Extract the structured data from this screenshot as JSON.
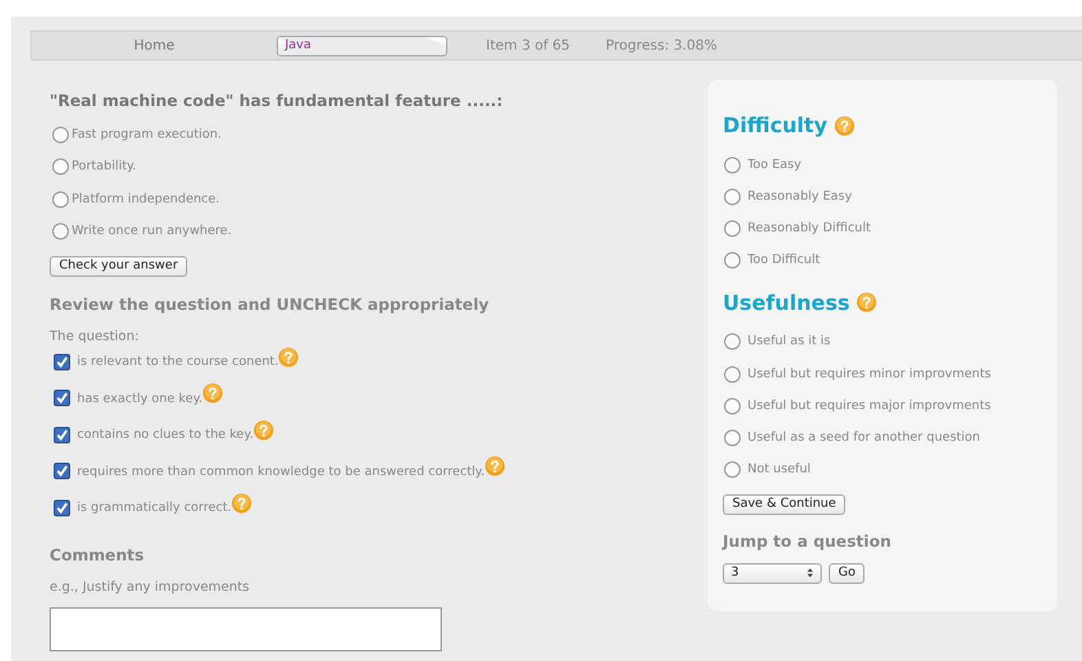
{
  "breadcrumb": [
    {
      "label": "Home",
      "selected": false
    },
    {
      "label": "Java",
      "selected": true
    }
  ],
  "position": "Item 3 of 65",
  "progress": "Progress: 3.08%",
  "question": {
    "title": "\"Real machine code\" has fundamental feature .....:",
    "options": [
      {
        "label": "Fast program execution.",
        "selected": false
      },
      {
        "label": "Portability.",
        "selected": false
      },
      {
        "label": "Platform independence.",
        "selected": false
      },
      {
        "label": "Write once run anywhere.",
        "selected": false
      }
    ],
    "check_button": "Check your answer"
  },
  "review": {
    "heading": "Review the question and UNCHECK appropriately",
    "intro": "The question:",
    "criteria": [
      {
        "label": "is relevant to the course conent.",
        "checked": true
      },
      {
        "label": "has exactly one key.",
        "checked": true
      },
      {
        "label": "contains no clues to the key.",
        "checked": true
      },
      {
        "label": "requires more than common knowledge to be answered correctly.",
        "checked": true
      },
      {
        "label": "is grammatically correct.",
        "checked": true
      }
    ]
  },
  "comments": {
    "heading": "Comments",
    "hint": "e.g., Justify any improvements"
  },
  "difficulty": {
    "heading": "Difficulty",
    "options": [
      {
        "label": "Too Easy",
        "selected": false
      },
      {
        "label": "Reasonably Easy",
        "selected": false
      },
      {
        "label": "Reasonably Difficult",
        "selected": false
      },
      {
        "label": "Too Difficult",
        "selected": false
      }
    ]
  },
  "usefulness": {
    "heading": "Usefulness",
    "options": [
      {
        "label": "Useful as it is",
        "selected": false
      },
      {
        "label": "Useful but requires minor improvments",
        "selected": false
      },
      {
        "label": "Useful but requires major improvments",
        "selected": false
      },
      {
        "label": "Useful as a seed for another question",
        "selected": false
      },
      {
        "label": "Not useful",
        "selected": false
      }
    ]
  },
  "save_button": "Save & Continue",
  "jump": {
    "heading": "Jump to a question",
    "value": "3",
    "go_button": "Go"
  }
}
